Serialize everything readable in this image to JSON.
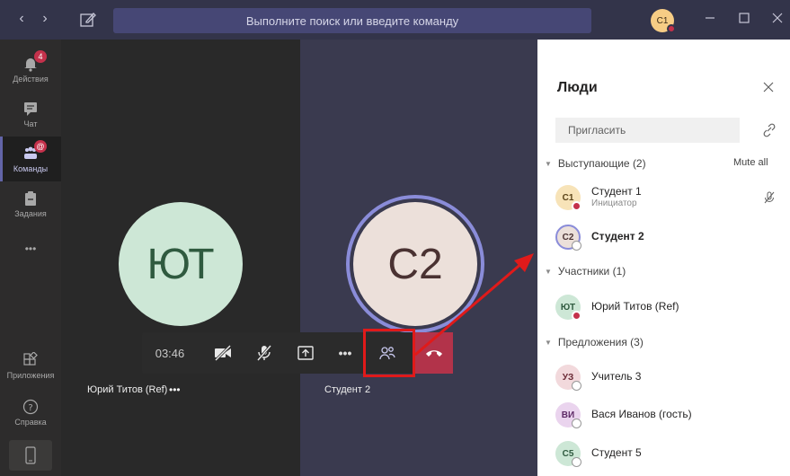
{
  "topbar": {
    "back_glyph": "‹",
    "forward_glyph": "›",
    "search_placeholder": "Выполните поиск или введите команду",
    "avatar_initials": "C1"
  },
  "rail": {
    "items": [
      {
        "label": "Действия",
        "icon": "bell-icon",
        "badge": "4"
      },
      {
        "label": "Чат",
        "icon": "chat-icon"
      },
      {
        "label": "Команды",
        "icon": "teams-icon",
        "badge": "@"
      },
      {
        "label": "Задания",
        "icon": "assignments-icon"
      },
      {
        "label": "•••",
        "icon": "more-icon"
      },
      {
        "label": "Приложения",
        "icon": "apps-icon"
      },
      {
        "label": "Справка",
        "icon": "help-icon"
      }
    ]
  },
  "stage": {
    "left_initials": "ЮТ",
    "right_initials": "C2",
    "left_name": "Юрий Титов (Ref)",
    "left_more": "•••",
    "right_name": "Студент 2"
  },
  "controls": {
    "timer": "03:46",
    "more": "•••"
  },
  "people_panel": {
    "title": "Люди",
    "invite_placeholder": "Пригласить",
    "presenters_section": "Выступающие (2)",
    "mute_all": "Mute all",
    "presenters": [
      {
        "initials": "C1",
        "name": "Студент 1",
        "sub": "Инициатор"
      },
      {
        "initials": "C2",
        "name": "Студент 2"
      }
    ],
    "attendees_section": "Участники (1)",
    "attendees": [
      {
        "initials": "ЮТ",
        "name": "Юрий Титов (Ref)"
      }
    ],
    "suggestions_section": "Предложения (3)",
    "suggestions": [
      {
        "initials": "УЗ",
        "name": "Учитель 3"
      },
      {
        "initials": "ВИ",
        "name": "Вася Иванов (гость)"
      },
      {
        "initials": "C5",
        "name": "Студент 5"
      }
    ]
  },
  "colors": {
    "accent": "#6264a7",
    "hangup": "#b2334a",
    "highlight": "#e01a1a"
  }
}
